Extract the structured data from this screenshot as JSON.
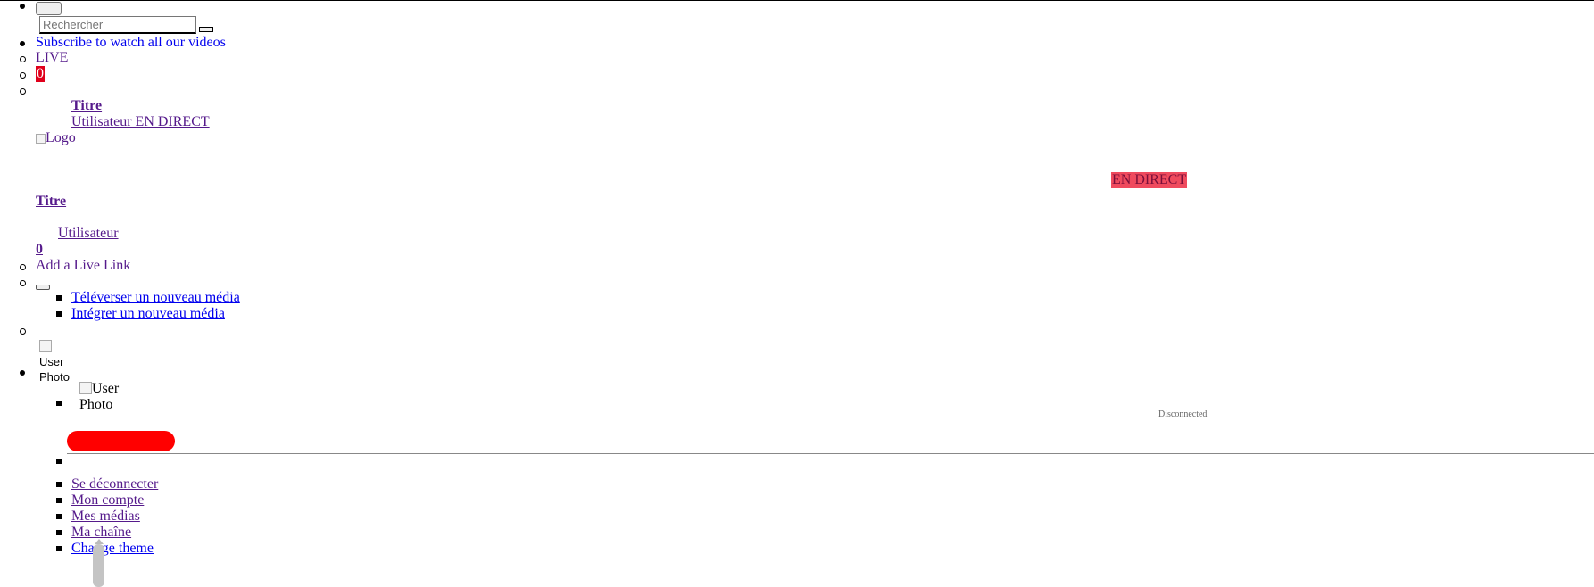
{
  "search": {
    "placeholder": "Rechercher"
  },
  "nav": {
    "subscribe_label": "Subscribe to watch all our videos",
    "live_label": "LIVE",
    "live_count": "0",
    "live_item": {
      "title": "Titre",
      "user_line": "Utilisateur EN DIRECT",
      "logo_alt": "Logo",
      "badge": "EN DIRECT",
      "title2": "Titre",
      "user": "Utilisateur",
      "count": "0"
    },
    "add_live_link": "Add a Live Link",
    "upload_menu": {
      "upload_label": "Téléverser un nouveau média",
      "embed_label": "Intégrer un nouveau média"
    }
  },
  "user_menu": {
    "photo_alt_line1": "User",
    "photo_alt_line2": "Photo",
    "status": "Disconnected",
    "items": [
      {
        "label": "Se déconnecter"
      },
      {
        "label": "Mon compte"
      },
      {
        "label": "Mes médias"
      },
      {
        "label": "Ma chaîne"
      },
      {
        "label": "Change theme"
      }
    ]
  },
  "colors": {
    "live_badge_bg": "#ef4a5e",
    "count_badge_bg": "#e0001b",
    "redaction": "#ff0000"
  }
}
